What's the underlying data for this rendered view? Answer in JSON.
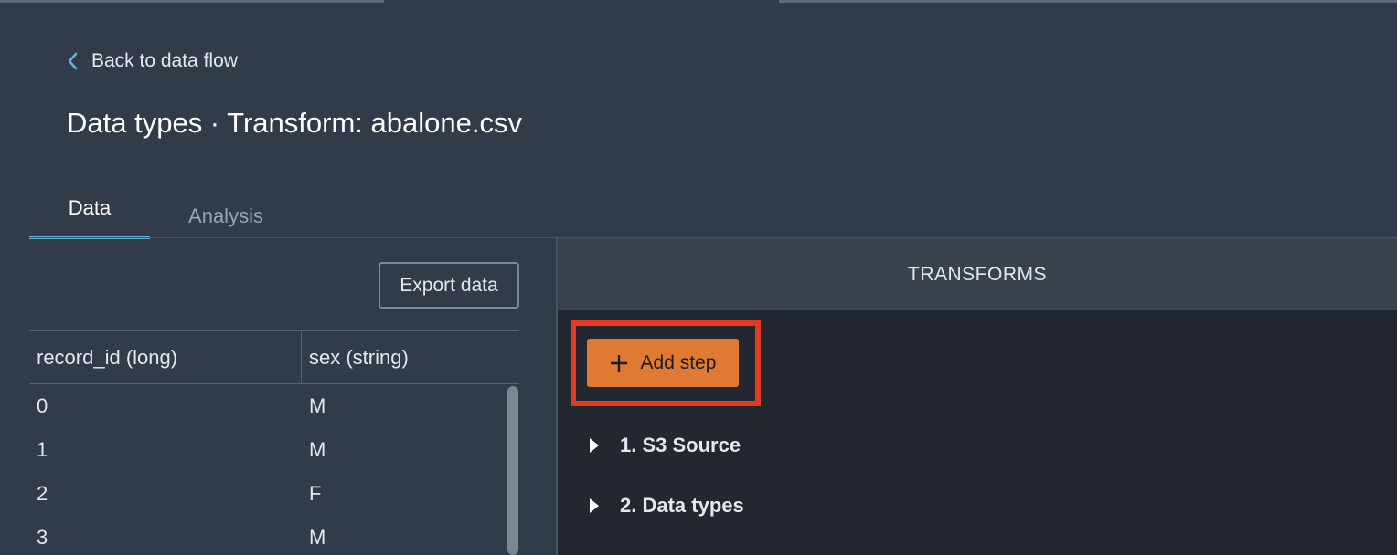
{
  "nav": {
    "back_label": "Back to data flow"
  },
  "page": {
    "title": "Data types · Transform: abalone.csv"
  },
  "tabs": [
    {
      "label": "Data",
      "active": true
    },
    {
      "label": "Analysis",
      "active": false
    }
  ],
  "data_panel": {
    "export_label": "Export data",
    "columns": [
      "record_id (long)",
      "sex (string)"
    ],
    "rows": [
      [
        "0",
        "M"
      ],
      [
        "1",
        "M"
      ],
      [
        "2",
        "F"
      ],
      [
        "3",
        "M"
      ]
    ]
  },
  "transforms": {
    "header": "TRANSFORMS",
    "add_step_label": "Add step",
    "steps": [
      "1. S3 Source",
      "2. Data types"
    ]
  },
  "colors": {
    "background": "#323b4a",
    "accent_orange": "#e07934",
    "highlight_red": "#e23a25",
    "tab_underline": "#63b3d8"
  }
}
